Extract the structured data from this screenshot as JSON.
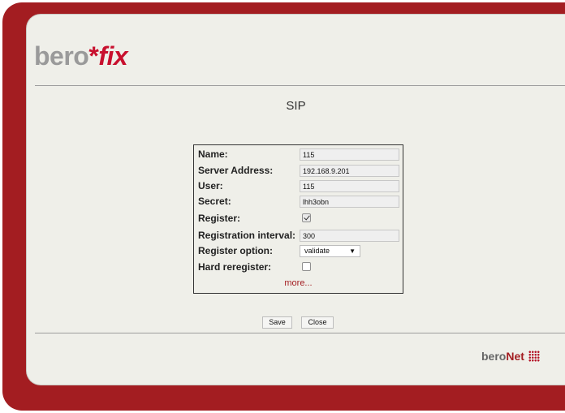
{
  "brand": {
    "bero": "bero",
    "star": "*",
    "fix": "fix"
  },
  "page": {
    "title": "SIP"
  },
  "form": {
    "name": {
      "label": "Name:",
      "value": "115"
    },
    "server_address": {
      "label": "Server Address:",
      "value": "192.168.9.201"
    },
    "user": {
      "label": "User:",
      "value": "115"
    },
    "secret": {
      "label": "Secret:",
      "value": "lhh3obn"
    },
    "register": {
      "label": "Register:",
      "checked": true
    },
    "registration_interval": {
      "label": "Registration interval:",
      "value": "300"
    },
    "register_option": {
      "label": "Register option:",
      "value": "validate",
      "arrow": "▼"
    },
    "hard_reregister": {
      "label": "Hard reregister:",
      "checked": false
    },
    "more_link": "more..."
  },
  "buttons": {
    "save": "Save",
    "close": "Close"
  },
  "footer": {
    "brand_part1": "bero",
    "brand_part2": "Net"
  },
  "colors": {
    "frame": "#a31d21",
    "panel": "#efefe9",
    "accent": "#c8102e"
  }
}
